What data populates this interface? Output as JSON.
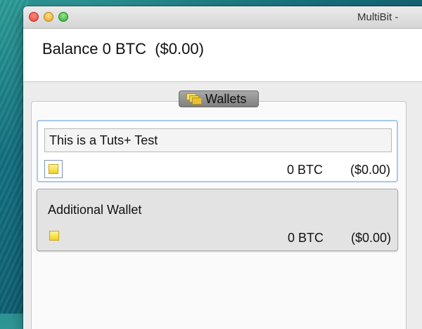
{
  "window": {
    "title": "MultiBit - "
  },
  "header": {
    "balance_text": "Balance 0 BTC  ($0.00)"
  },
  "wallets_panel": {
    "tab_label": "Wallets",
    "tab_icon": "wallets-stack-icon",
    "wallets": [
      {
        "name": "This is a Tuts+ Test",
        "btc": "0 BTC",
        "fiat": "($0.00)",
        "selected": true,
        "icon": "wallet-icon"
      },
      {
        "name": "Additional Wallet",
        "btc": "0 BTC",
        "fiat": "($0.00)",
        "selected": false,
        "icon": "wallet-icon"
      }
    ]
  },
  "colors": {
    "selected_border": "#a9c8ec",
    "wallet_icon_yellow": "#f2d21f",
    "tab_background": "#8f8f8f"
  }
}
